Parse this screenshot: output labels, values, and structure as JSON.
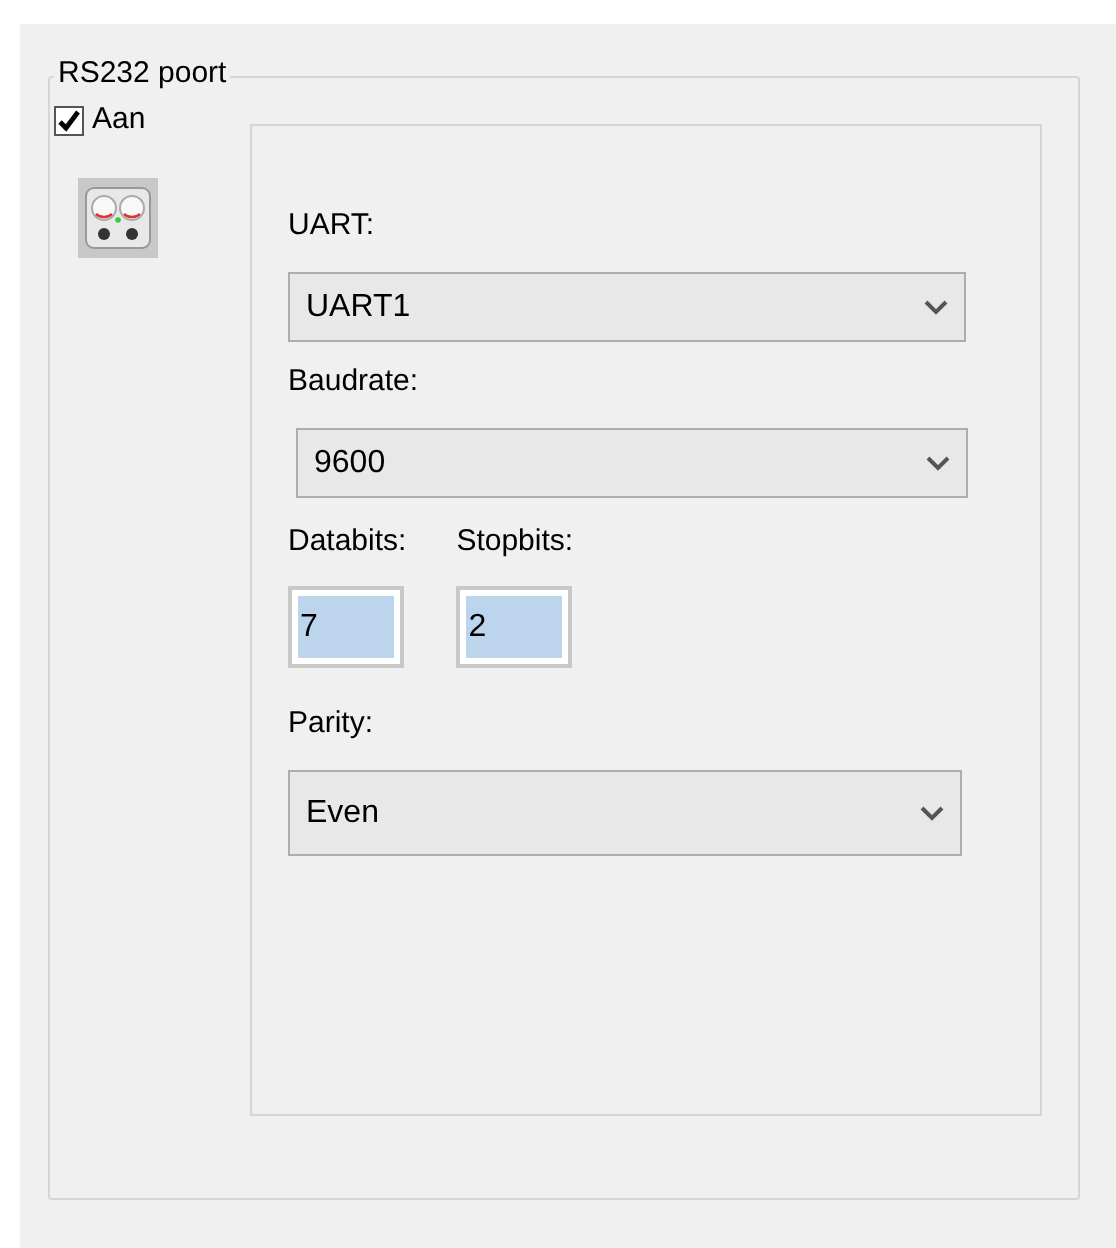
{
  "group": {
    "title": "RS232 poort"
  },
  "enable": {
    "label": "Aan",
    "checked": true
  },
  "uart": {
    "label": "UART:",
    "value": "UART1"
  },
  "baudrate": {
    "label": "Baudrate:",
    "value": "9600"
  },
  "bits": [
    {
      "label": "Databits:",
      "value": "7",
      "highlighted": true
    },
    {
      "label": "Stopbits:",
      "value": "2",
      "highlighted": true
    }
  ],
  "parity": {
    "label": "Parity:",
    "value": "Even"
  }
}
